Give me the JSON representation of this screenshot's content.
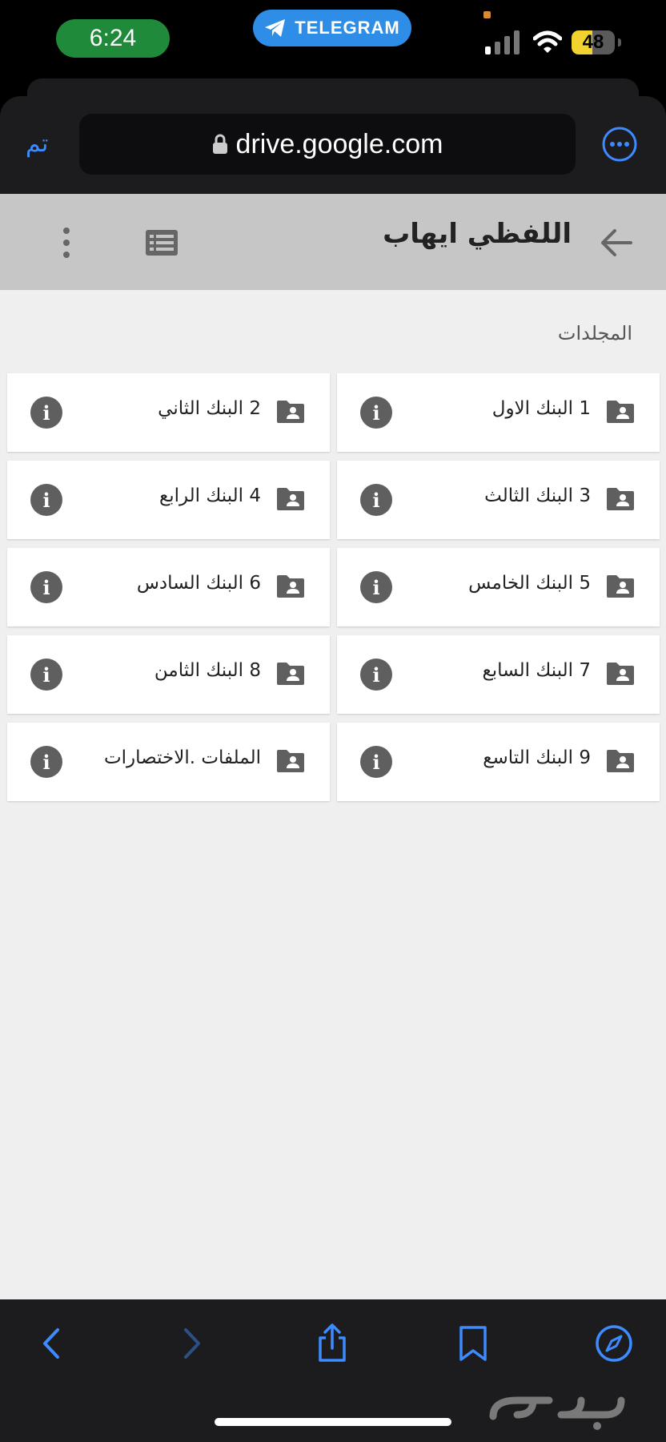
{
  "status_bar": {
    "time": "6:24",
    "telegram_label": "TELEGRAM",
    "battery_level": "48"
  },
  "browser": {
    "done_label": "تم",
    "url": "drive.google.com"
  },
  "header": {
    "title": "اللفظي ايهاب"
  },
  "section": {
    "label": "المجلدات"
  },
  "folders": [
    {
      "label": "1 البنك الاول"
    },
    {
      "label": "2 البنك الثاني"
    },
    {
      "label": "3 البنك الثالث"
    },
    {
      "label": "4 البنك الرابع"
    },
    {
      "label": "5 البنك الخامس"
    },
    {
      "label": "6 البنك السادس"
    },
    {
      "label": "7 البنك السابع"
    },
    {
      "label": "8 البنك الثامن"
    },
    {
      "label": "9 البنك التاسع"
    },
    {
      "label": "الملفات .الاختصارات"
    }
  ],
  "icons": {
    "folder": "shared-folder-icon",
    "info": "info-icon",
    "more": "more-options-icon",
    "list_view": "list-view-icon",
    "back": "back-arrow-icon"
  },
  "colors": {
    "accent": "#3d8bff",
    "header_bg": "#c6c6c6",
    "content_bg": "#efefef",
    "telegram": "#2e8de6",
    "time_pill": "#1f8a3a"
  }
}
